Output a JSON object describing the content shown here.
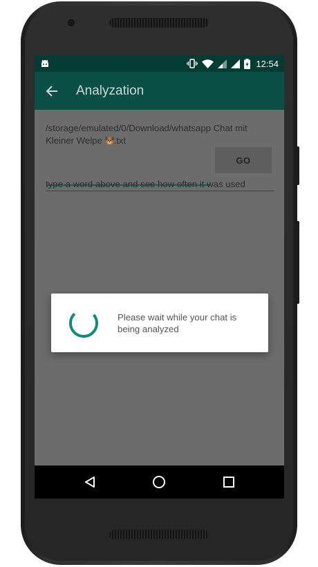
{
  "status_bar": {
    "time": "12:54",
    "icons": [
      "android-icon",
      "vibrate-icon",
      "wifi-icon",
      "signal-icon",
      "signal-icon",
      "battery-charging-icon"
    ]
  },
  "app_bar": {
    "title": "Analyzation",
    "back_icon": "arrow-left-icon"
  },
  "content": {
    "file_path_prefix": "/storage/emulated/0/Download/whatsapp Chat mit Kleiner Welpe ",
    "file_path_emoji": "dog-face-emoji",
    "file_path_suffix": ".txt",
    "word_input": {
      "value": "",
      "placeholder": ""
    },
    "go_label": "GO",
    "hint": "type a word above and see how often it was used"
  },
  "dialog": {
    "message": "Please wait while your chat is being analyzed"
  },
  "nav_bar": {
    "icons": [
      "back-triangle-icon",
      "home-circle-icon",
      "recents-square-icon"
    ]
  },
  "colors": {
    "status_bar": "#043b33",
    "app_bar": "#0a4f45",
    "accent": "#14897a",
    "screen_dim": "#6c6c6c"
  }
}
